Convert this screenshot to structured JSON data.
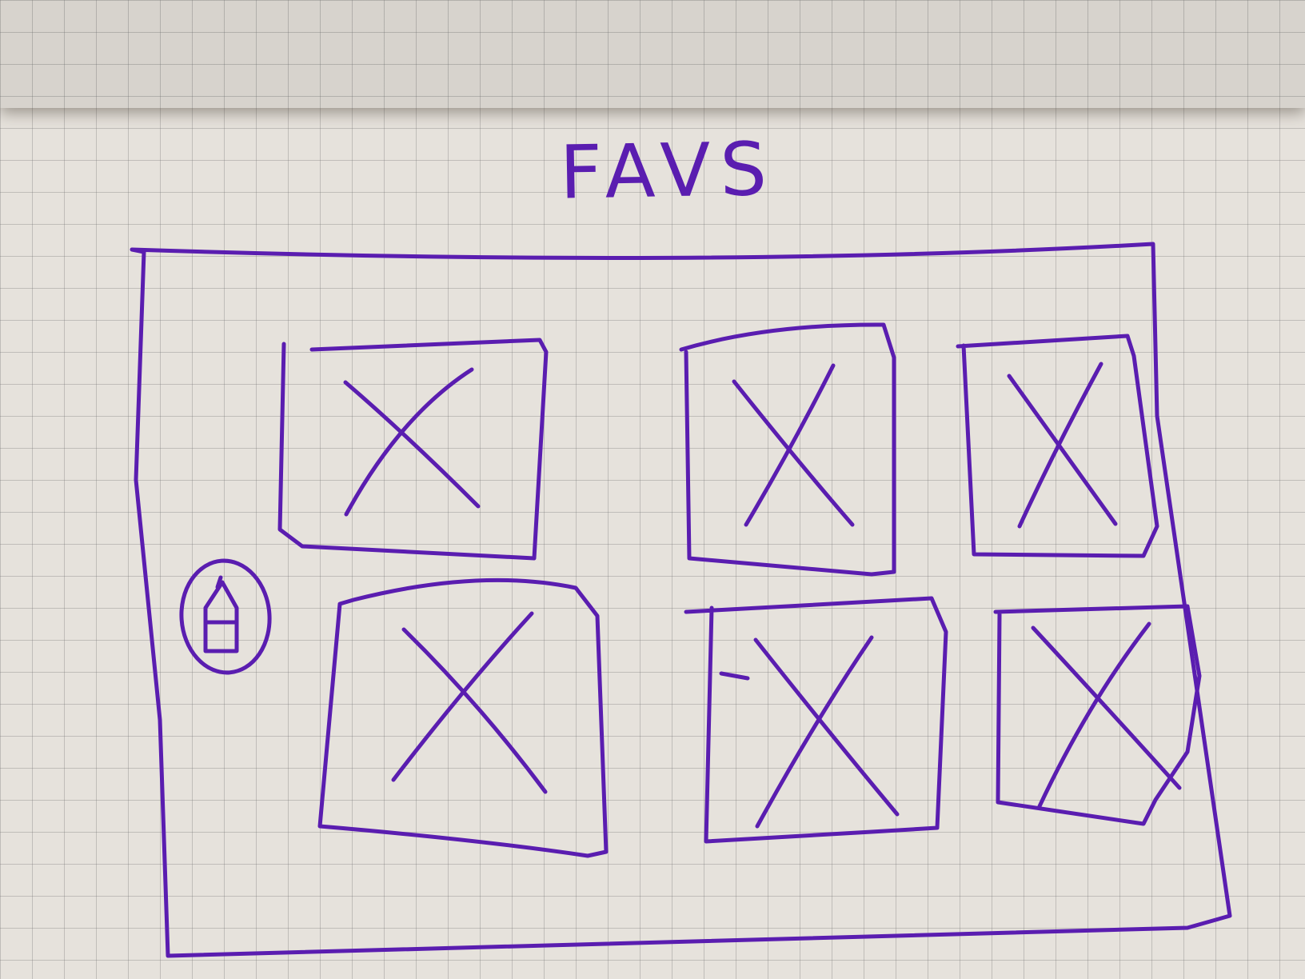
{
  "title": "FAVS",
  "pen_color": "#5a1db0",
  "home_icon": "home-icon",
  "favorites": [
    {
      "icon": "image-placeholder-icon"
    },
    {
      "icon": "image-placeholder-icon"
    },
    {
      "icon": "image-placeholder-icon"
    },
    {
      "icon": "image-placeholder-icon"
    },
    {
      "icon": "image-placeholder-icon"
    },
    {
      "icon": "image-placeholder-icon"
    }
  ]
}
